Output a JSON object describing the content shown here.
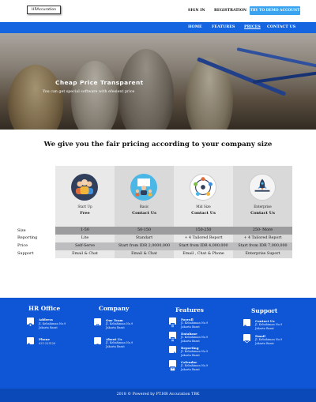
{
  "header": {
    "logo_text": "HRAccuration",
    "sign_in": "SIGN IN",
    "registration": "REGISTRATION",
    "demo_button": "TRY TO DEMO ACCOUNT"
  },
  "nav": {
    "items": [
      "HOME",
      "FEATURES",
      "PRICES",
      "CONTACT US"
    ],
    "active": "PRICES"
  },
  "hero": {
    "title": "Cheap Price Transparent",
    "subtitle": "You can get special software with efesient price"
  },
  "pricing": {
    "heading": "We give you the fair pricing according to your company size",
    "row_labels": [
      "Size",
      "Reporting",
      "Price",
      "Support"
    ],
    "plans": [
      {
        "name": "Start Up",
        "cta": "Free",
        "icon": "team-icon",
        "size": "1-50",
        "reporting": "Lite",
        "price": "Self-Serve",
        "support": "Email & Chat"
      },
      {
        "name": "Basic",
        "cta": "Contact Us",
        "icon": "presenter-icon",
        "size": "50-150",
        "reporting": "Standart",
        "price": "Start from IDR 2,0000,000",
        "support": "Email & Chat"
      },
      {
        "name": "Mid Size",
        "cta": "Contact Us",
        "icon": "network-icon",
        "size": "150-250",
        "reporting": "+ 4 Tailored Report",
        "price": "Start from IDR 4,000,000",
        "support": "Email , Chat & Phone"
      },
      {
        "name": "Enterprise",
        "cta": "Contact Us",
        "icon": "rocket-icon",
        "size": "250- More",
        "reporting": "+ 4 Tailored Report",
        "price": "Start from IDR 7,000,000",
        "support": "Enterprise Suport"
      }
    ]
  },
  "footer": {
    "hr_office": {
      "title": "HR Office",
      "address_label": "Address",
      "address_lines": [
        "Jl. Kebahiman No.9",
        "Jakarta Barat"
      ],
      "phone_label": "Phone",
      "phone": "021-223120"
    },
    "company": {
      "title": "Company",
      "our_team_label": "Our Team",
      "our_team_lines": [
        "Jl. Kebahiman No.9",
        "Jakarta Barat"
      ],
      "about_label": "About Us",
      "about_lines": [
        "Jl. Kebahiman No.9",
        "Jakarta Barat"
      ]
    },
    "features": {
      "title": "Features",
      "items": [
        {
          "label": "Payroll",
          "lines": [
            "Jl. Kebahiman No.9",
            "Jakarta Barat"
          ]
        },
        {
          "label": "Database",
          "lines": [
            "Jl. Kebahiman No.9",
            "Jakarta Barat"
          ]
        },
        {
          "label": "Reporting",
          "lines": [
            "Jl. Kebahiman No.9",
            "Jakarta Barat"
          ]
        },
        {
          "label": "Calendar",
          "lines": [
            "Jl. Kebahiman No.9",
            "Jakarta Barat"
          ]
        }
      ]
    },
    "support": {
      "title": "Support",
      "contact_label": "Contact Us",
      "contact_lines": [
        "Jl. Kebahiman No.9",
        "Jakarta Barat"
      ],
      "email_label": "Email",
      "email_lines": [
        "Jl. Kebahiman No.9",
        "Jakarta Barat"
      ]
    },
    "copyright": "2018 © Powered by PT.HR Accuration TBK"
  },
  "colors": {
    "nav_blue": "#1565e0",
    "footer_blue": "#0f56d6",
    "demo_button": "#3aa3f0"
  }
}
